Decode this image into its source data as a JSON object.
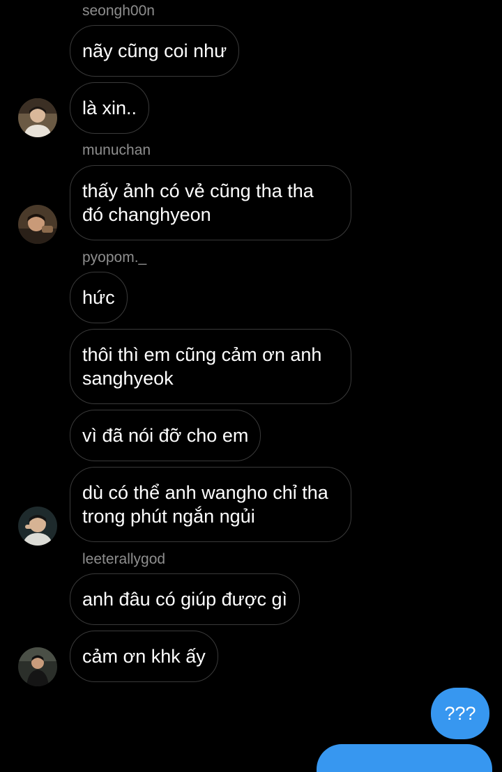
{
  "messages": [
    {
      "sender": "seongh00n",
      "texts": [
        "nãy cũng coi như",
        "là xin.."
      ]
    },
    {
      "sender": "munuchan",
      "texts": [
        "thấy ảnh có vẻ cũng tha tha đó changhyeon"
      ]
    },
    {
      "sender": "pyopom._",
      "texts": [
        "hức",
        "thôi thì em cũng cảm ơn anh sanghyeok",
        "vì đã nói đỡ cho em",
        "dù có thể anh wangho chỉ tha trong phút ngắn ngủi"
      ]
    },
    {
      "sender": "leeterallygod",
      "texts": [
        "anh đâu có giúp được gì",
        "cảm ơn khk ấy"
      ]
    }
  ],
  "my_message": "???",
  "colors": {
    "background": "#000000",
    "bubble_border": "#3a3a3a",
    "sender_text": "#8e8e8e",
    "my_bubble": "#3797f0"
  }
}
